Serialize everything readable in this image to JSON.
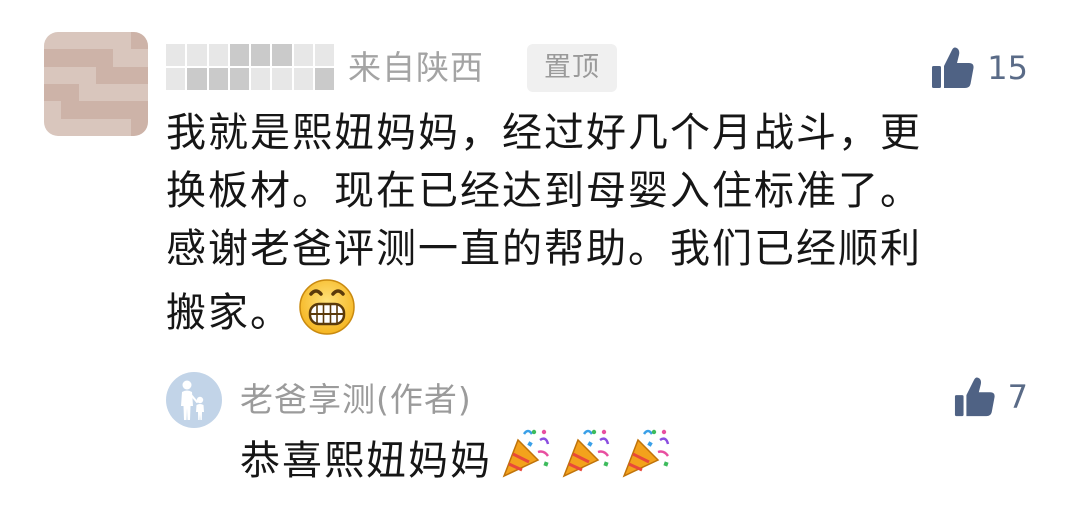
{
  "comment": {
    "author_name": "",
    "location": "来自陕西",
    "pinned_label": "置顶",
    "like_count": "15",
    "text": "我就是熙妞妈妈，经过好几个月战斗，更\n换板材。现在已经达到母婴入住标准了。\n感谢老爸评测一直的帮助。我们已经顺利\n搬家。",
    "trailing_emoji": "grinning-face-emoji"
  },
  "reply": {
    "author_name": "老爸享测(作者)",
    "like_count": "7",
    "text": "恭喜熙妞妈妈",
    "trailing_emojis": [
      "party-popper-emoji",
      "party-popper-emoji",
      "party-popper-emoji"
    ]
  },
  "colors": {
    "like_icon": "#4f6284",
    "meta_text": "#a4a4a4",
    "body_text": "#161616",
    "badge_bg": "#f0f0f0"
  }
}
